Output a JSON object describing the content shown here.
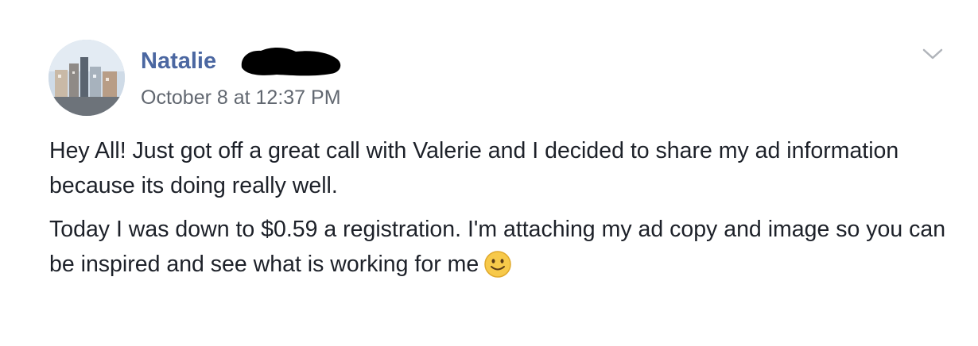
{
  "post": {
    "author_name": "Natalie",
    "timestamp": "October 8 at 12:37 PM",
    "paragraphs": [
      "Hey All! Just got off a great call with Valerie and I decided to share my ad information because its doing really well.",
      "Today I was down to $0.59 a registration. I'm attaching my ad copy and image so you can be inspired and see what is working for me"
    ],
    "emoji": "slightly-smiling-face-icon",
    "menu_icon": "chevron-down-icon",
    "name_color": "#4b67a1",
    "text_color": "#1d2129",
    "meta_color": "#616770"
  }
}
